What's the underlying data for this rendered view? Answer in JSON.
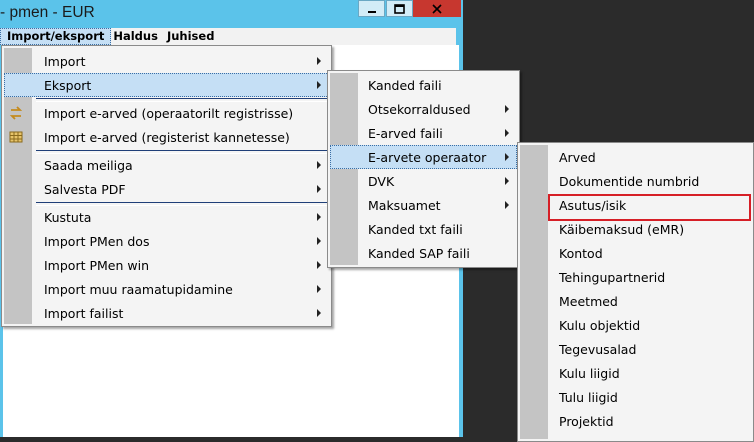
{
  "window": {
    "title": "- pmen - EUR"
  },
  "menubar": {
    "items": [
      "Import/eksport",
      "Haldus",
      "Juhised"
    ]
  },
  "menu1": {
    "items": [
      {
        "label": "Import",
        "arrow": true,
        "group": 0
      },
      {
        "label": "Eksport",
        "arrow": true,
        "group": 0,
        "highlighted": true
      },
      {
        "label": "Import e-arved (operaatorilt registrisse)",
        "arrow": false,
        "group": 1,
        "icon": "arrows-swap-icon"
      },
      {
        "label": "Import e-arved (registerist kannetesse)",
        "arrow": false,
        "group": 1,
        "icon": "table-grid-icon"
      },
      {
        "label": "Saada meiliga",
        "arrow": true,
        "group": 2
      },
      {
        "label": "Salvesta PDF",
        "arrow": true,
        "group": 2
      },
      {
        "label": "Kustuta",
        "arrow": true,
        "group": 3
      },
      {
        "label": "Import PMen dos",
        "arrow": true,
        "group": 3
      },
      {
        "label": "Import PMen win",
        "arrow": true,
        "group": 3
      },
      {
        "label": "Import muu raamatupidamine",
        "arrow": true,
        "group": 3
      },
      {
        "label": "Import failist",
        "arrow": true,
        "group": 3
      }
    ]
  },
  "menu2": {
    "items": [
      {
        "label": "Kanded faili",
        "arrow": false
      },
      {
        "label": "Otsekorraldused",
        "arrow": true
      },
      {
        "label": "E-arved faili",
        "arrow": true
      },
      {
        "label": "E-arvete operaator",
        "arrow": true,
        "highlighted": true
      },
      {
        "label": "DVK",
        "arrow": true
      },
      {
        "label": "Maksuamet",
        "arrow": true
      },
      {
        "label": "Kanded txt faili",
        "arrow": false
      },
      {
        "label": "Kanded SAP faili",
        "arrow": false
      }
    ]
  },
  "menu3": {
    "items": [
      {
        "label": "Arved"
      },
      {
        "label": "Dokumentide numbrid"
      },
      {
        "label": "Asutus/isik",
        "boxed": true
      },
      {
        "label": "Käibemaksud (eMR)"
      },
      {
        "label": "Kontod"
      },
      {
        "label": "Tehingupartnerid"
      },
      {
        "label": "Meetmed"
      },
      {
        "label": "Kulu objektid"
      },
      {
        "label": "Tegevusalad"
      },
      {
        "label": "Kulu liigid"
      },
      {
        "label": "Tulu liigid"
      },
      {
        "label": "Projektid"
      }
    ]
  },
  "colors": {
    "highlight": "#c5dff5",
    "annotation": "#d61f26",
    "window_frame": "#5bc3ea",
    "close_button": "#c7372f"
  }
}
